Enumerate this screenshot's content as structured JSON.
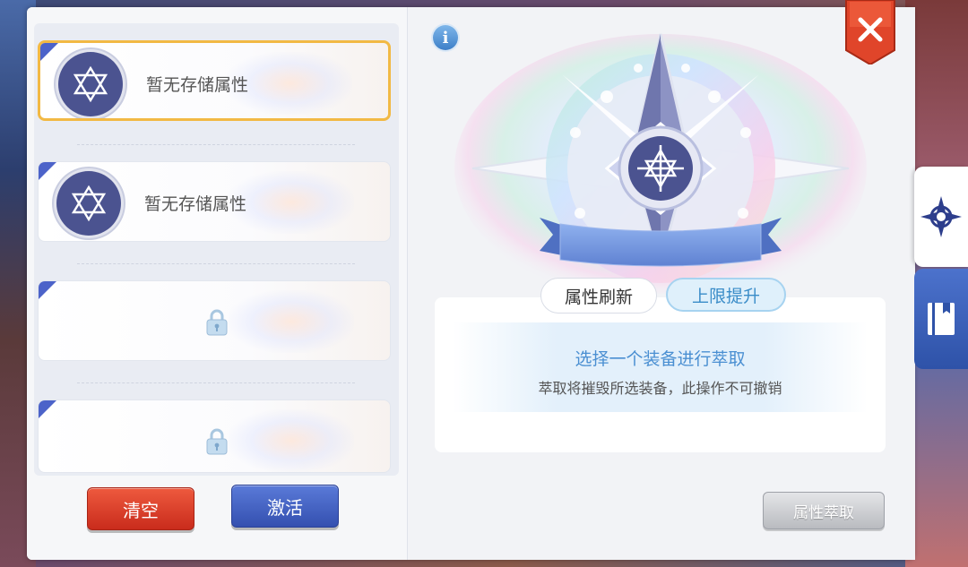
{
  "slots": [
    {
      "label": "暂无存储属性",
      "state": "selected"
    },
    {
      "label": "暂无存储属性",
      "state": "empty"
    },
    {
      "label": "",
      "state": "locked"
    },
    {
      "label": "",
      "state": "locked"
    }
  ],
  "buttons": {
    "clear_label": "清空",
    "activate_label": "激活",
    "extract_label": "属性萃取"
  },
  "tabs": {
    "refresh_label": "属性刷新",
    "upgrade_label": "上限提升",
    "active_tab": "上限提升"
  },
  "info": {
    "title": "选择一个装备进行萃取",
    "description": "萃取将摧毁所选装备，此操作不可撤销",
    "icon_glyph": "i"
  },
  "icons": {
    "close": "close-icon",
    "compass_tab": "compass-star-icon",
    "book_tab": "book-icon",
    "slot_emblem": "hexagram-icon",
    "lock": "lock-icon"
  },
  "colors": {
    "selected_border": "#f2b944",
    "clear_button": "#d63a26",
    "activate_button": "#3f5ec0",
    "accent_blue": "#4a8fd2",
    "close_button": "#e0452a"
  }
}
